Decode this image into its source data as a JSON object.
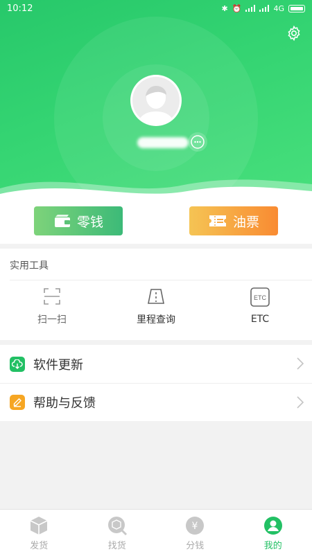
{
  "status_bar": {
    "time": "10:12",
    "network": "4G"
  },
  "wallet": {
    "change_label": "零钱",
    "fuel_label": "油票"
  },
  "tools": {
    "title": "实用工具",
    "items": [
      {
        "label": "扫一扫",
        "icon": "scan-icon"
      },
      {
        "label": "里程查询",
        "icon": "road-icon"
      },
      {
        "label": "ETC",
        "icon": "etc-icon",
        "icon_text": "ETC"
      }
    ]
  },
  "menu": [
    {
      "label": "软件更新",
      "icon": "download-cloud-icon",
      "color": "#22c064"
    },
    {
      "label": "帮助与反馈",
      "icon": "edit-icon",
      "color": "#f6a623"
    }
  ],
  "bottom_nav": [
    {
      "label": "发货",
      "icon": "box-icon"
    },
    {
      "label": "找货",
      "icon": "search-box-icon"
    },
    {
      "label": "分钱",
      "icon": "yen-icon",
      "icon_text": "¥"
    },
    {
      "label": "我的",
      "icon": "user-icon",
      "active": true
    }
  ],
  "colors": {
    "brand_green": "#22c064",
    "change_gradient": [
      "#7ed37a",
      "#3cba78"
    ],
    "fuel_gradient": [
      "#f5c454",
      "#f98b32"
    ]
  }
}
